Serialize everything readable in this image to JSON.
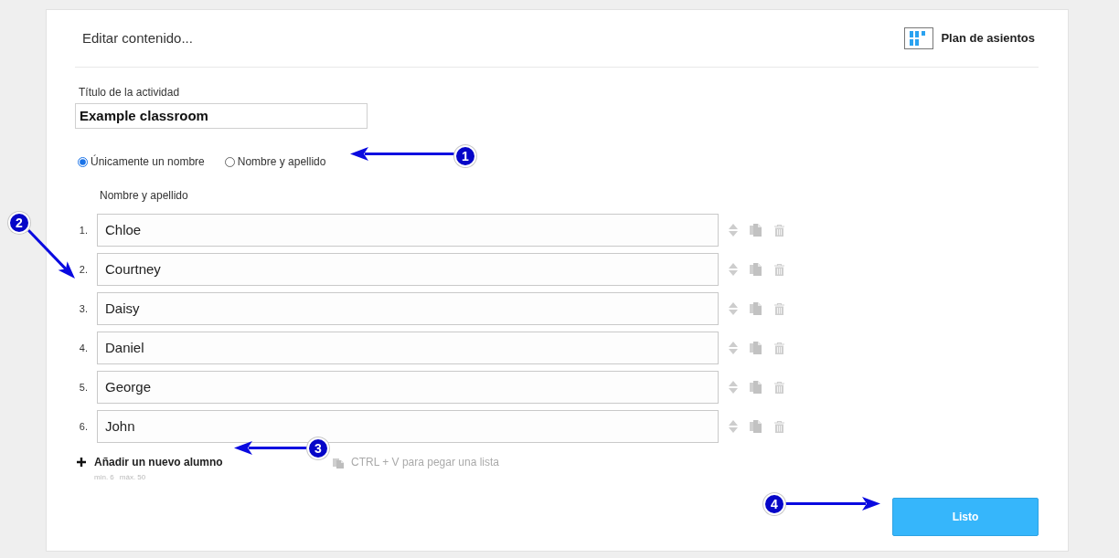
{
  "header": {
    "title": "Editar contenido...",
    "seating_plan": "Plan de asientos"
  },
  "activity_title": {
    "label": "Título de la actividad",
    "value": "Example classroom"
  },
  "name_mode": [
    {
      "label": "Únicamente un nombre",
      "selected": true
    },
    {
      "label": "Nombre y apellido",
      "selected": false
    }
  ],
  "students": {
    "column_label": "Nombre y apellido",
    "rows": [
      {
        "number": "1.",
        "name": "Chloe"
      },
      {
        "number": "2.",
        "name": "Courtney"
      },
      {
        "number": "3.",
        "name": "Daisy"
      },
      {
        "number": "4.",
        "name": "Daniel"
      },
      {
        "number": "5.",
        "name": "George"
      },
      {
        "number": "6.",
        "name": "John"
      }
    ]
  },
  "add_student": {
    "label": "Añadir un nuevo alumno",
    "limits": [
      "min. 6",
      "máx. 50"
    ],
    "paste_hint": "CTRL + V para pegar una lista"
  },
  "done_button": "Listo",
  "annotations": [
    {
      "number": "1"
    },
    {
      "number": "2"
    },
    {
      "number": "3"
    },
    {
      "number": "4"
    }
  ]
}
